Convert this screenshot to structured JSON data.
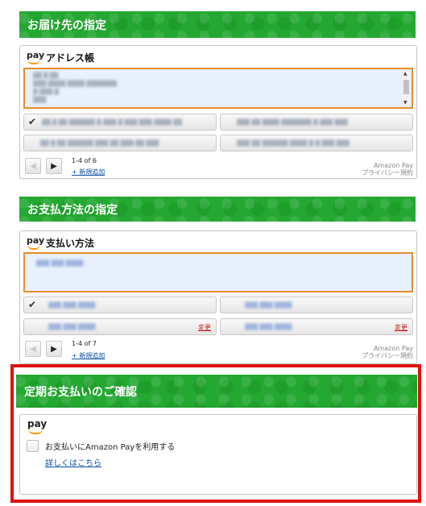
{
  "address_section": {
    "header": "お届け先の指定",
    "widget_title": "アドレス帳",
    "pay_logo": "pay",
    "selected_lines": [
      "▓▓ ▓ ▓▓",
      "▓▓▓-▓▓▓▓ ▓▓▓▓ ▓▓▓▓▓▓▓",
      "▓-▓▓▓-▓",
      "▓▓▓"
    ],
    "items": [
      {
        "text": "▓▓ ▓ ▓▓ ▓▓▓▓▓▓ ▓-▓▓▓-▓ ▓▓▓ ▓▓▓-▓▓▓▓ ▓▓",
        "checked": true
      },
      {
        "text": "▓▓▓ ▓▓ ▓▓▓▓ ▓▓▓▓▓▓▓ ▓-▓▓▓ ▓▓▓",
        "checked": false
      },
      {
        "text": "▓▓ ▓ ▓▓ ▓▓▓▓▓▓ ▓▓▓ ▓▓ ▓▓▓-▓▓ ▓▓▓",
        "checked": false
      },
      {
        "text": "▓▓▓ ▓▓ ▓▓▓▓▓▓ ▓▓▓▓ ▓-▓ ▓▓▓ ▓▓▓",
        "checked": false
      }
    ],
    "page_count": "1-4 of 6",
    "add_new": "+ 新規追加",
    "footer_line1": "Amazon Pay",
    "footer_line2": "プライバシー規約"
  },
  "payment_section": {
    "header": "お支払方法の指定",
    "widget_title": "支払い方法",
    "pay_logo": "pay",
    "selected_text": "▓▓▓ ▓▓▓ ▓▓▓▓",
    "items": [
      {
        "text": "▓▓▓ ▓▓▓ ▓▓▓▓",
        "checked": true,
        "change": ""
      },
      {
        "text": "▓▓▓ ▓▓▓ ▓▓▓▓",
        "checked": false,
        "change": ""
      },
      {
        "text": "▓▓▓ ▓▓▓ ▓▓▓▓",
        "checked": false,
        "change": "変更"
      },
      {
        "text": "▓▓▓ ▓▓▓ ▓▓▓▓",
        "checked": false,
        "change": "変更"
      }
    ],
    "page_count": "1-4 of 7",
    "add_new": "+ 新規追加",
    "footer_line1": "Amazon Pay",
    "footer_line2": "プライバシー規約"
  },
  "recurring_section": {
    "header": "定期お支払いのご確認",
    "pay_logo": "pay",
    "consent_label": "お支払いにAmazon Payを利用する",
    "details_link": "詳しくはこちら"
  },
  "colors": {
    "header_green": "#24a832",
    "highlight_red": "#e01010",
    "selection_orange": "#e98b2b",
    "link_blue": "#0a4ea8"
  }
}
